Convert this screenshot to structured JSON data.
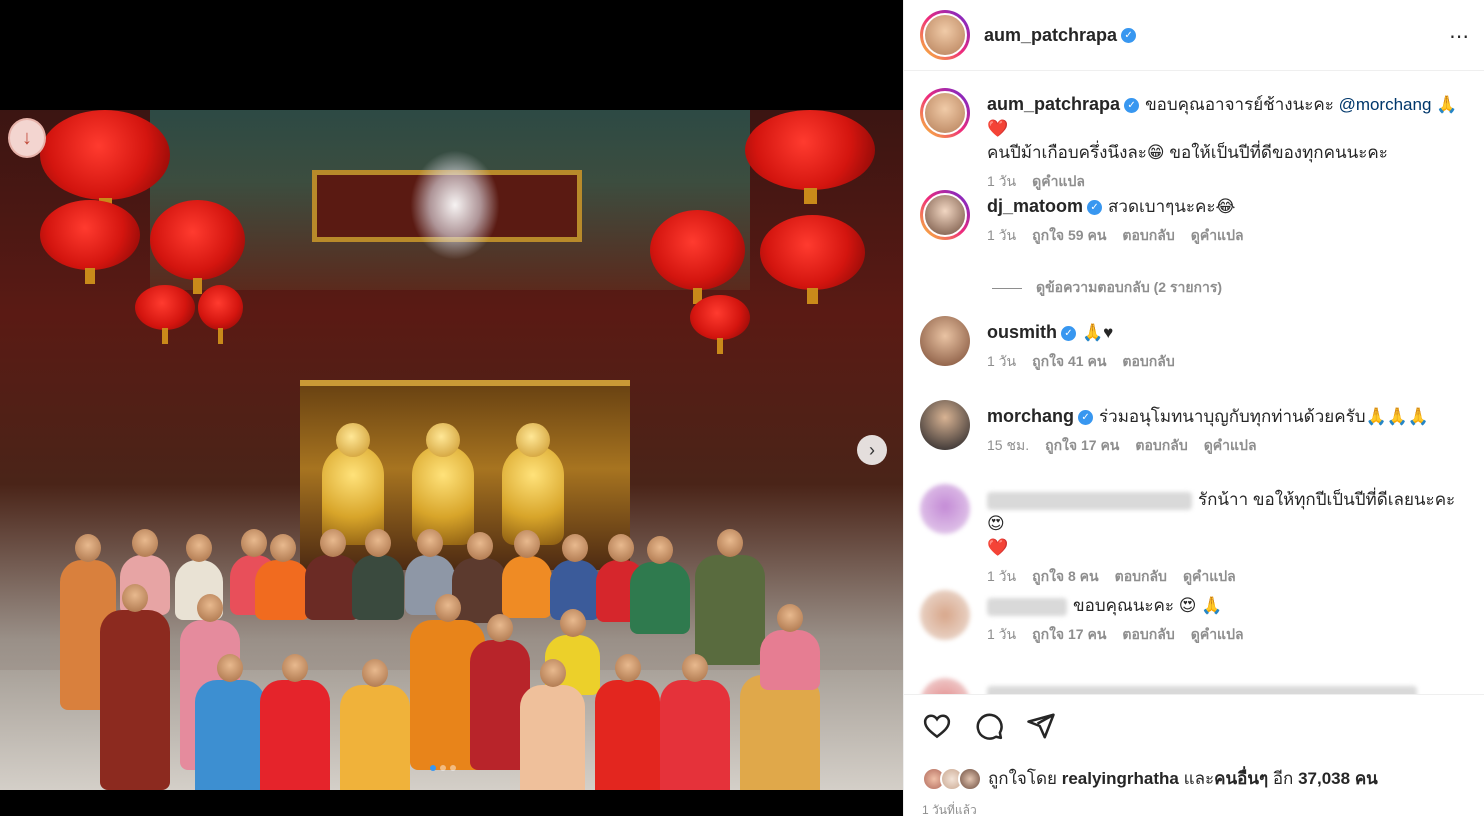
{
  "post": {
    "author": "aum_patchrapa",
    "time_ago": "1 วันที่แล้ว",
    "likes": {
      "prefix": "ถูกใจโดย",
      "first_user": "realyingrhatha",
      "joiner": "และ",
      "others_label": "คนอื่นๆ",
      "count_prefix": "อีก",
      "count": "37,038",
      "count_suffix": "คน"
    }
  },
  "caption": {
    "username": "aum_patchrapa",
    "text_1": "ขอบคุณอาจารย์ช้างนะคะ",
    "mention": "@morchang",
    "emoji_1": "🙏❤️",
    "text_2": "คนปีม้าเกือบครึ่งนึงละ😁 ขอให้เป็นปีที่ดีของทุกคนนะคะ",
    "time": "1 วัน",
    "translate": "ดูคำแปล"
  },
  "comments": [
    {
      "username": "dj_matoom",
      "verified": true,
      "text": "สวดเบาๆนะคะ😂",
      "time": "1 วัน",
      "likes": "ถูกใจ 59 คน",
      "reply": "ตอบกลับ",
      "translate": "ดูคำแปล"
    },
    {
      "username": "ousmith",
      "verified": true,
      "text": "🙏♥",
      "time": "1 วัน",
      "likes": "ถูกใจ 41 คน",
      "reply": "ตอบกลับ"
    },
    {
      "username": "morchang",
      "verified": true,
      "text": "ร่วมอนุโมทนาบุญกับทุกท่านด้วยครับ🙏🙏🙏",
      "time": "15 ชม.",
      "likes": "ถูกใจ 17 คน",
      "reply": "ตอบกลับ",
      "translate": "ดูคำแปล"
    },
    {
      "text": "รักน้าา ขอให้ทุกปีเป็นปีที่ดีเลยนะคะ😍",
      "text_2": "❤️",
      "time": "1 วัน",
      "likes": "ถูกใจ 8 คน",
      "reply": "ตอบกลับ",
      "translate": "ดูคำแปล"
    },
    {
      "text": "ขอบคุณนะคะ 😍 🙏",
      "time": "1 วัน",
      "likes": "ถูกใจ 17 คน",
      "reply": "ตอบกลับ",
      "translate": "ดูคำแปล"
    }
  ],
  "view_replies": "ดูข้อความตอบกลับ (2 รายการ)",
  "icons": {
    "like": "heart-icon",
    "comment": "comment-icon",
    "share": "share-icon",
    "save": "bookmark-icon",
    "more": "more-options-icon",
    "next": "chevron-right-icon",
    "verified": "verified-badge-icon"
  },
  "colors": {
    "verified": "#3897f0",
    "text": "#262626",
    "muted": "#8e8e8e",
    "mention": "#00376b"
  }
}
